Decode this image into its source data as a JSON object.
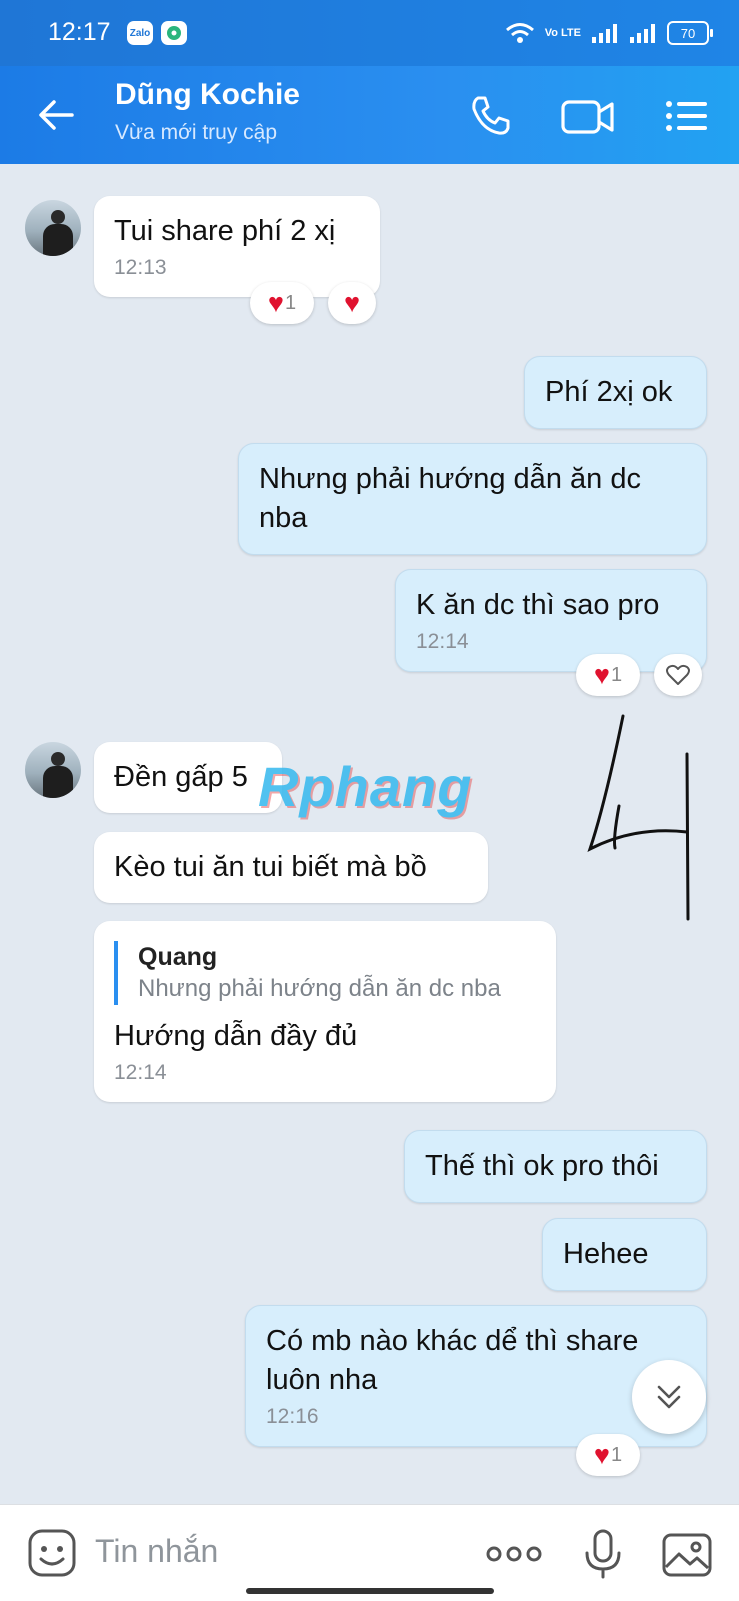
{
  "status_bar": {
    "time": "12:17",
    "app_zalo": "Zalo",
    "volte": "Vo LTE",
    "battery": "70"
  },
  "header": {
    "contact_name": "Dũng Kochie",
    "contact_status": "Vừa mới truy cập",
    "icons": [
      "back-arrow-icon",
      "phone-icon",
      "video-call-icon",
      "menu-list-icon"
    ]
  },
  "messages": [
    {
      "side": "in",
      "text": "Tui share phí 2 xị",
      "time": "12:13",
      "reaction_count": "1"
    },
    {
      "side": "out",
      "text": "Phí 2xị ok"
    },
    {
      "side": "out",
      "text": "Nhưng phải hướng dẫn ăn dc nba"
    },
    {
      "side": "out",
      "text": "K ăn dc thì sao pro",
      "time": "12:14",
      "reaction_count": "1"
    },
    {
      "side": "in",
      "text": "Đền gấp 5"
    },
    {
      "side": "in",
      "text": "Kèo tui ăn tui biết mà bồ"
    },
    {
      "side": "in",
      "reply_name": "Quang",
      "reply_text": "Nhưng phải hướng dẫn ăn dc nba",
      "text": "Hướng dẫn đầy đủ",
      "time": "12:14"
    },
    {
      "side": "out",
      "text": "Thế thì ok pro thôi"
    },
    {
      "side": "out",
      "text": "Hehee"
    },
    {
      "side": "out",
      "text": "Có mb nào khác dể thì share luôn nha",
      "time": "12:16",
      "reaction_count": "1"
    }
  ],
  "watermark": "Rphang",
  "input_bar": {
    "placeholder": "Tin nhắn",
    "icons": [
      "sticker-icon",
      "more-dots-icon",
      "microphone-icon",
      "image-icon"
    ]
  },
  "colors": {
    "header": "#1c7be6",
    "outgoing_bubble": "#d7eefc",
    "incoming_bubble": "#ffffff",
    "chat_background": "#e2e9f1",
    "heart": "#e0122f"
  }
}
